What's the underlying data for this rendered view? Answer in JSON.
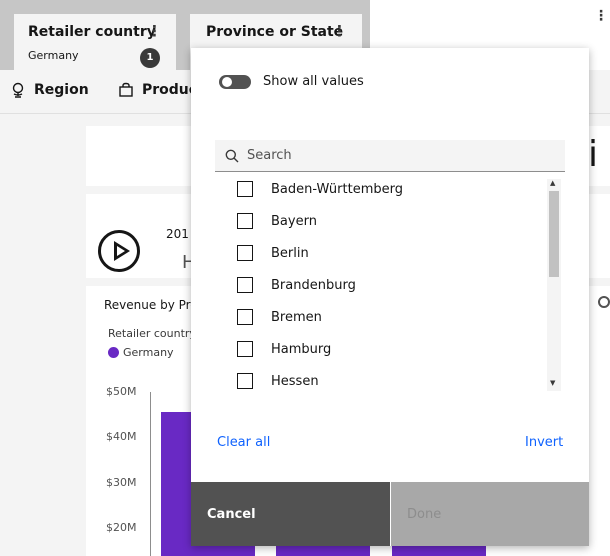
{
  "filters": [
    {
      "title": "Retailer country",
      "value": "Germany",
      "count": "1"
    },
    {
      "title": "Province or State"
    }
  ],
  "nav": [
    {
      "label": "Region",
      "icon": "globe-icon"
    },
    {
      "label": "Product",
      "icon": "shopping-bag-icon"
    }
  ],
  "dashboard": {
    "year_text": "201",
    "h_text": "H",
    "partial_title": "i",
    "chart_title": "Revenue by Pro",
    "legend_title": "Retailer country",
    "legend_item": "Germany",
    "accent_color": "#6929c4",
    "y_ticks": [
      "$50M",
      "$40M",
      "$30M",
      "$20M"
    ]
  },
  "chart_data": {
    "type": "bar",
    "title": "Revenue by Pro",
    "series": [
      {
        "name": "Germany",
        "values": [
          45.5,
          44,
          44
        ]
      }
    ],
    "ylim": [
      10,
      50
    ],
    "y_ticks": [
      "$50M",
      "$40M",
      "$30M",
      "$20M"
    ]
  },
  "dropdown": {
    "toggle_label": "Show all values",
    "toggle_on": false,
    "search_placeholder": "Search",
    "items": [
      {
        "label": "Baden-Württemberg",
        "checked": false
      },
      {
        "label": "Bayern",
        "checked": false
      },
      {
        "label": "Berlin",
        "checked": false
      },
      {
        "label": "Brandenburg",
        "checked": false
      },
      {
        "label": "Bremen",
        "checked": false
      },
      {
        "label": "Hamburg",
        "checked": false
      },
      {
        "label": "Hessen",
        "checked": false
      }
    ],
    "clear_all": "Clear all",
    "invert": "Invert",
    "cancel": "Cancel",
    "done": "Done"
  }
}
